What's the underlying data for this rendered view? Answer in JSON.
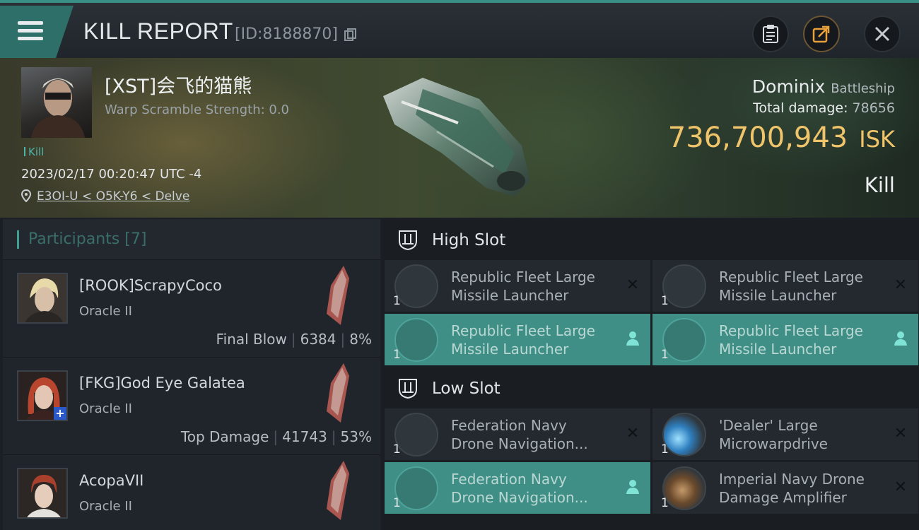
{
  "header": {
    "title": "KILL REPORT",
    "report_id": "[ID:8188870]",
    "icons": [
      "menu-icon",
      "clipboard-icon",
      "share-icon",
      "close-icon"
    ]
  },
  "victim": {
    "name": "[XST]会飞的猫熊",
    "warp_scramble": "Warp Scramble Strength: 0.0",
    "kill_tag": "Kill",
    "datetime": "2023/02/17 00:20:47 UTC -4",
    "location": "E3OI-U < O5K-Y6 < Delve",
    "ship_name": "Dominix",
    "ship_class": "Battleship",
    "total_damage_label": "Total damage:",
    "total_damage_value": "78656",
    "isk_value": "736,700,943",
    "isk_currency": "ISK",
    "result": "Kill"
  },
  "participants": {
    "title": "Participants",
    "count": "[7]",
    "items": [
      {
        "name": "[ROOK]ScrapyCoco",
        "ship": "Oracle II",
        "role": "Final Blow",
        "damage": "6384",
        "percent": "8%"
      },
      {
        "name": "[FKG]God Eye Galatea",
        "ship": "Oracle II",
        "role": "Top Damage",
        "damage": "41743",
        "percent": "53%",
        "badge": "+"
      },
      {
        "name": "AcopaVII",
        "ship": "Oracle II",
        "role": "",
        "damage": "",
        "percent": ""
      }
    ]
  },
  "fitting": {
    "high_slot": {
      "label": "High Slot",
      "modules": [
        {
          "qty": "1",
          "line1": "Republic Fleet Large",
          "line2": "Missile Launcher",
          "state": "destroyed"
        },
        {
          "qty": "1",
          "line1": "Republic Fleet Large",
          "line2": "Missile Launcher",
          "state": "destroyed"
        },
        {
          "qty": "1",
          "line1": "Republic Fleet Large",
          "line2": "Missile Launcher",
          "state": "dropped"
        },
        {
          "qty": "1",
          "line1": "Republic Fleet Large",
          "line2": "Missile Launcher",
          "state": "dropped"
        }
      ]
    },
    "low_slot": {
      "label": "Low Slot",
      "modules": [
        {
          "qty": "1",
          "line1": "Federation Navy",
          "line2": "Drone Navigation...",
          "state": "destroyed"
        },
        {
          "qty": "1",
          "line1": "'Dealer' Large",
          "line2": "Microwarpdrive",
          "state": "destroyed"
        },
        {
          "qty": "1",
          "line1": "Federation Navy",
          "line2": "Drone Navigation...",
          "state": "dropped"
        },
        {
          "qty": "1",
          "line1": "Imperial Navy Drone",
          "line2": "Damage Amplifier",
          "state": "destroyed"
        }
      ]
    }
  },
  "colors": {
    "accent": "#3f8f86",
    "isk": "#f0c46a",
    "background": "#1b1f25"
  }
}
